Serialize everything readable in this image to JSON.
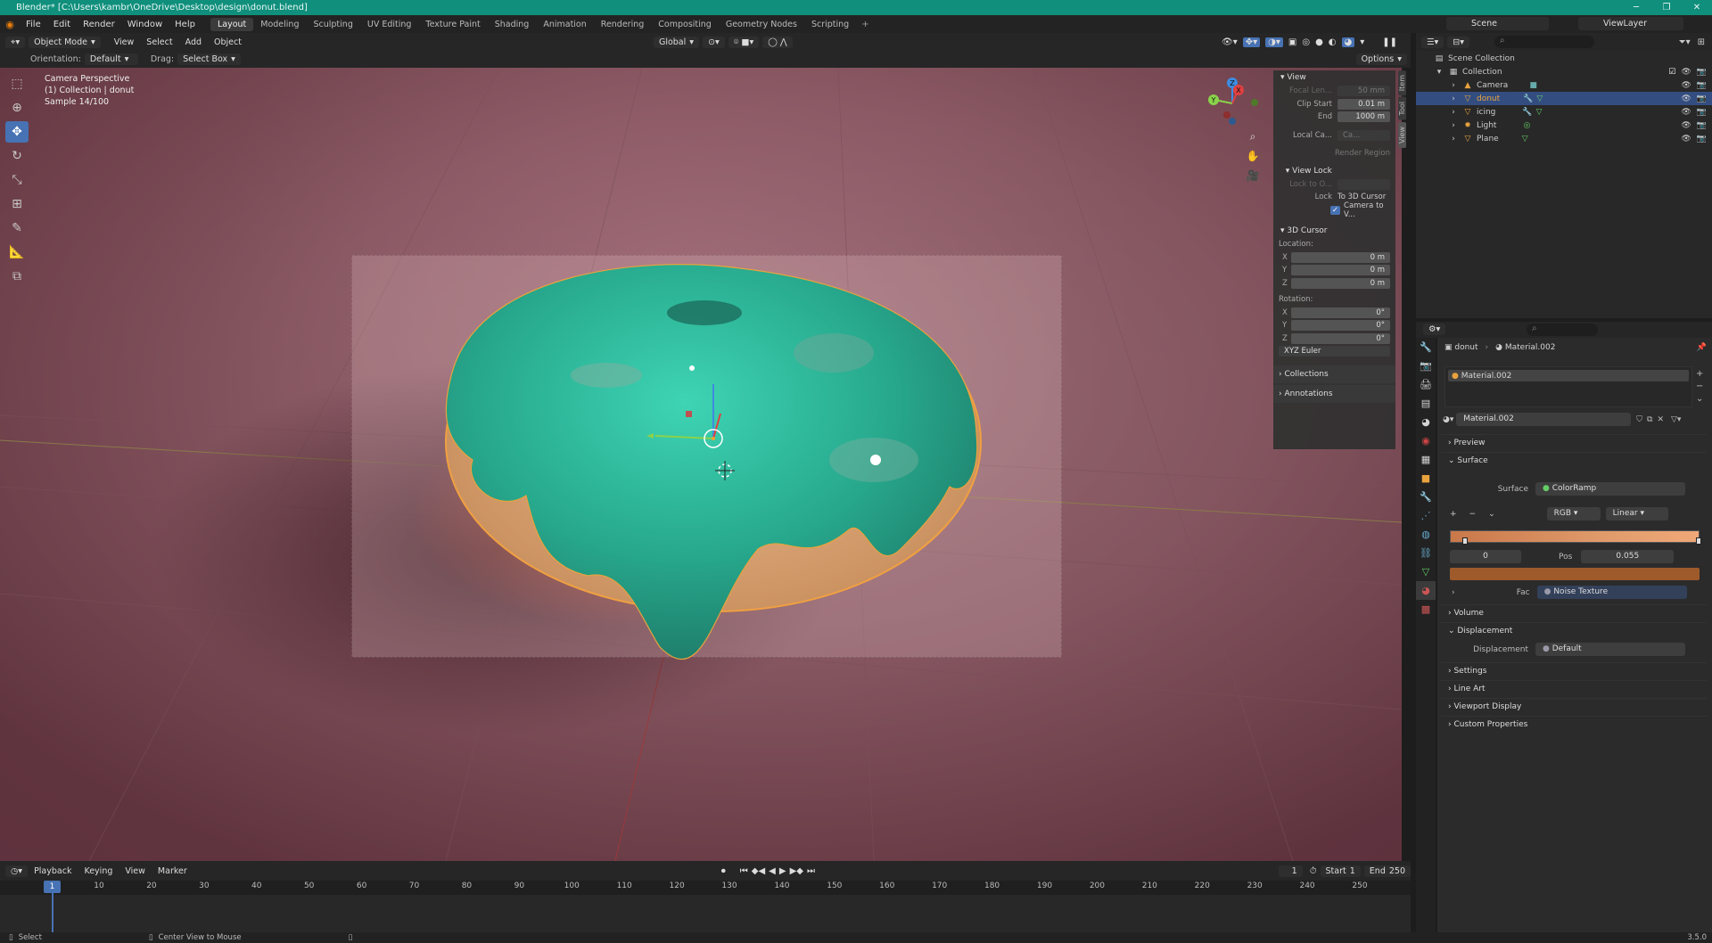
{
  "window": {
    "title": "Blender* [C:\\Users\\kambr\\OneDrive\\Desktop\\design\\donut.blend]"
  },
  "menu": {
    "items": [
      "File",
      "Edit",
      "Render",
      "Window",
      "Help"
    ]
  },
  "workspaces": [
    "Layout",
    "Modeling",
    "Sculpting",
    "UV Editing",
    "Texture Paint",
    "Shading",
    "Animation",
    "Rendering",
    "Compositing",
    "Geometry Nodes",
    "Scripting"
  ],
  "scene": {
    "name": "Scene",
    "view_layer": "ViewLayer"
  },
  "viewport_header": {
    "mode": "Object Mode",
    "menus": [
      "View",
      "Select",
      "Add",
      "Object"
    ],
    "transform": "Global"
  },
  "tool_header": {
    "orientation_label": "Orientation:",
    "orientation": "Default",
    "drag_label": "Drag:",
    "drag": "Select Box",
    "options": "Options"
  },
  "viewport_info": {
    "line1": "Camera Perspective",
    "line2": "(1) Collection | donut",
    "line3": "Sample 14/100"
  },
  "npanel": {
    "tabs": [
      "Item",
      "Tool",
      "View"
    ],
    "view": {
      "title": "View",
      "focal_label": "Focal Len...",
      "focal": "50 mm",
      "clip_start_label": "Clip Start",
      "clip_start": "0.01 m",
      "end_label": "End",
      "end": "1000 m",
      "local_cam_label": "Local Ca...",
      "local_cam": "Ca...",
      "render_region": "Render Region"
    },
    "view_lock": {
      "title": "View Lock",
      "lock_to_label": "Lock to O...",
      "lock_label": "Lock",
      "to_3d_cursor": "To 3D Cursor",
      "camera_to_view": "Camera to V..."
    },
    "cursor": {
      "title": "3D Cursor",
      "location_label": "Location:",
      "x": "0 m",
      "y": "0 m",
      "z": "0 m",
      "rotation_label": "Rotation:",
      "rx": "0°",
      "ry": "0°",
      "rz": "0°",
      "mode": "XYZ Euler"
    },
    "collections": "Collections",
    "annotations": "Annotations"
  },
  "outliner": {
    "root": "Scene Collection",
    "collection": "Collection",
    "items": [
      {
        "name": "Camera",
        "selected": false
      },
      {
        "name": "donut",
        "selected": true
      },
      {
        "name": "icing",
        "selected": false
      },
      {
        "name": "Light",
        "selected": false
      },
      {
        "name": "Plane",
        "selected": false
      }
    ]
  },
  "properties": {
    "breadcrumb_object": "donut",
    "breadcrumb_material": "Material.002",
    "slot": "Material.002",
    "material_name": "Material.002",
    "sections": {
      "preview": "Preview",
      "surface": "Surface",
      "volume": "Volume",
      "displacement": "Displacement",
      "settings": "Settings",
      "line_art": "Line Art",
      "viewport_display": "Viewport Display",
      "custom_properties": "Custom Properties"
    },
    "surface_label": "Surface",
    "surface_value": "ColorRamp",
    "ramp_mode": "RGB",
    "ramp_interp": "Linear",
    "stop_index": "0",
    "pos_label": "Pos",
    "pos_value": "0.055",
    "fac_label": "Fac",
    "fac_value": "Noise Texture",
    "displacement_label": "Displacement",
    "displacement_value": "Default"
  },
  "timeline": {
    "menus": [
      "Playback",
      "Keying",
      "View",
      "Marker"
    ],
    "current_frame": "1",
    "start_label": "Start",
    "start": "1",
    "end_label": "End",
    "end": "250",
    "ticks": [
      "1",
      "10",
      "20",
      "30",
      "40",
      "50",
      "60",
      "70",
      "80",
      "90",
      "100",
      "110",
      "120",
      "130",
      "140",
      "150",
      "160",
      "170",
      "180",
      "190",
      "200",
      "210",
      "220",
      "230",
      "240",
      "250"
    ]
  },
  "status": {
    "select": "Select",
    "center_view": "Center View to Mouse",
    "version": "3.5.0"
  },
  "colors": {
    "accent": "#4772b3",
    "titlebar": "#0f8f7c",
    "selection": "#e8a33d",
    "icing": "#2bb89a"
  }
}
